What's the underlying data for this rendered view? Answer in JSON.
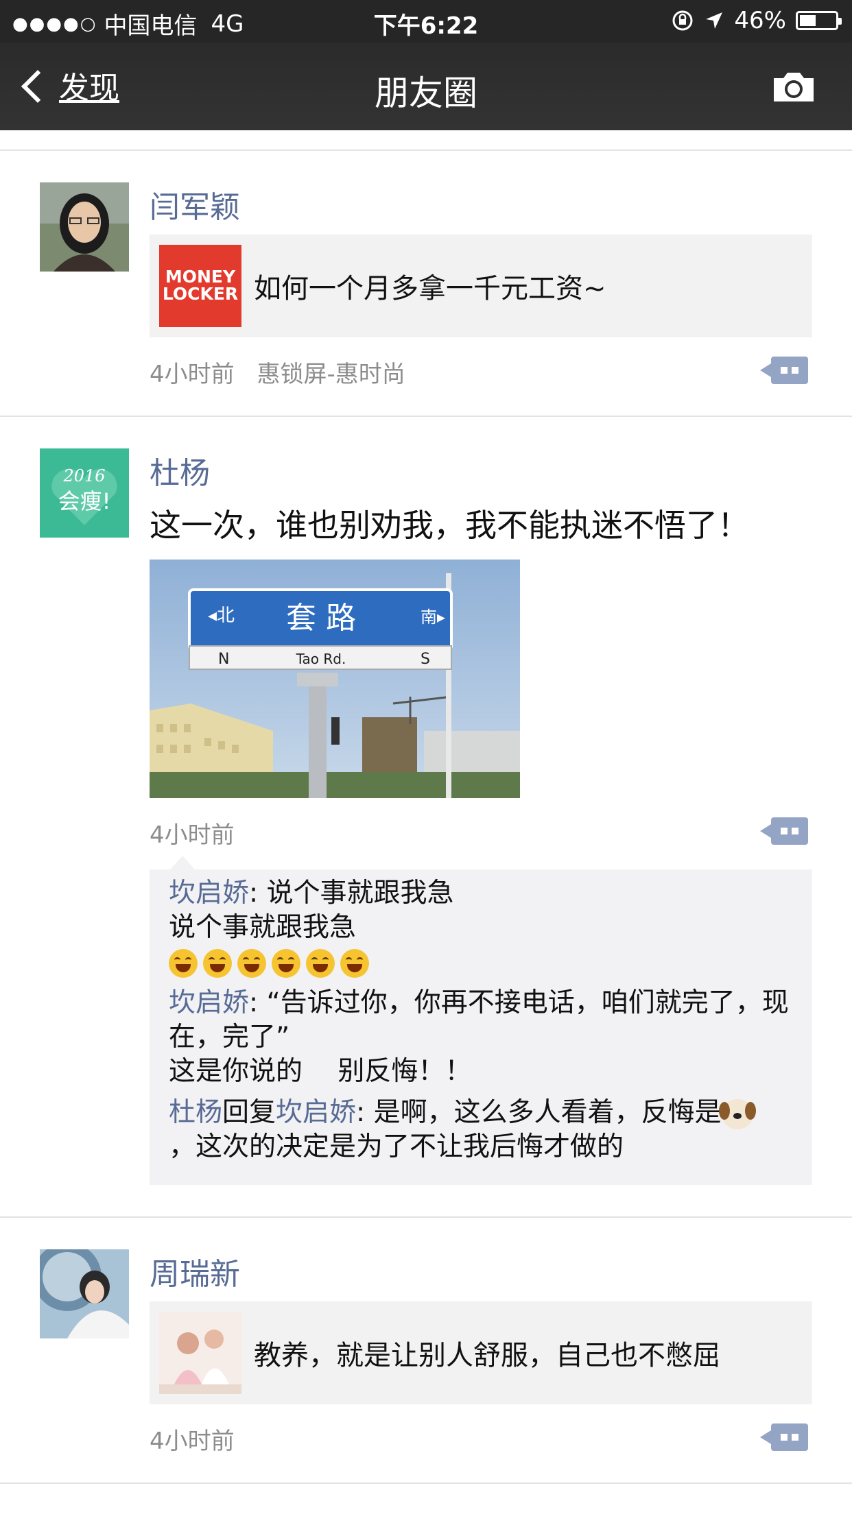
{
  "status_bar": {
    "signal_dots": "●●●●○",
    "carrier": "中国电信",
    "network": "4G",
    "time": "下午6:22",
    "battery": "46%",
    "battery_level": 0.46
  },
  "nav": {
    "back_label": "发现",
    "title": "朋友圈"
  },
  "posts": [
    {
      "author": "闫军颖",
      "link_thumb_text": "MONEY LOCKER",
      "link_title": "如何一个月多拿一千元工资~",
      "time": "4小时前",
      "source": "惠锁屏-惠时尚"
    },
    {
      "author": "杜杨",
      "avatar_text": "2016 会痩!",
      "text": "这一次，谁也别劝我，我不能执迷不悟了！",
      "photo": {
        "left": "◂北",
        "title": "套 路",
        "right": "南▸",
        "n": "N",
        "road": "Tao Rd.",
        "s": "S"
      },
      "time": "4小时前",
      "comments": [
        {
          "author": "坎启娇",
          "line1": ": 说个事就跟我急",
          "line2": "说个事就跟我急",
          "emoji_count": 6
        },
        {
          "author": "坎启娇",
          "line1": ": “告诉过你，你再不接电话，咱们就完了，现在，完了”",
          "line2": "这是你说的　 别反悔！！"
        },
        {
          "author": "杜杨",
          "reply_word": "回复",
          "reply_to": "坎启娇",
          "line1": ": 是啊，这么多人看着，反悔是",
          "line2": "，这次的决定是为了不让我后悔才做的"
        }
      ]
    },
    {
      "author": "周瑞新",
      "link_title": "教养，就是让别人舒服，自己也不憋屈",
      "time": "4小时前"
    }
  ]
}
